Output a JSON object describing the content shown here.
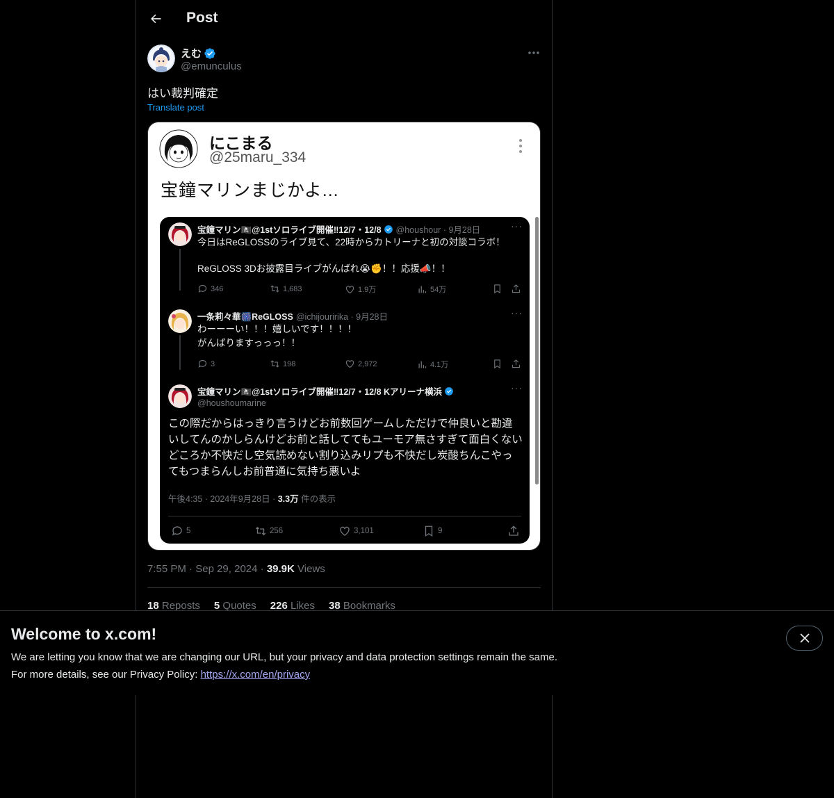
{
  "header": {
    "title": "Post"
  },
  "author": {
    "display_name": "えむ",
    "handle": "@emunculus"
  },
  "post": {
    "text": "はい裁判確定",
    "translate_label": "Translate post",
    "time": "7:55 PM",
    "date": "Sep 29, 2024",
    "views_count": "39.9K",
    "views_label": "Views"
  },
  "stats": [
    {
      "count": "18",
      "label": "Reposts"
    },
    {
      "count": "5",
      "label": "Quotes"
    },
    {
      "count": "226",
      "label": "Likes"
    },
    {
      "count": "38",
      "label": "Bookmarks"
    }
  ],
  "media": {
    "name": "にこまる",
    "handle": "@25maru_334",
    "text": "宝鐘マリンまじかよ...",
    "thread": {
      "first": {
        "name": "宝鐘マリン🏴‍☠️@1stソロライブ開催‼12/7・12/8",
        "meta": "@houshour · 9月28日",
        "line1": "今日はReGLOSSのライブ見て、22時からカトリーナと初の対談コラボ！",
        "line2": "ReGLOSS 3Dお披露目ライブがんばれ😭✊！！応援📣！！",
        "replies": "346",
        "reposts": "1,683",
        "likes": "1.9万",
        "views": "54万"
      },
      "second": {
        "name": "一条莉々華🎆ReGLOSS",
        "meta": "@ichijouririka · 9月28日",
        "line1": "わーーーい！！！嬉しいです！！！！",
        "line2": "がんばりますっっっ！！",
        "replies": "3",
        "reposts": "198",
        "likes": "2,972",
        "views": "4.1万"
      },
      "main": {
        "name": "宝鐘マリン🏴‍☠️@1stソロライブ開催‼12/7・12/8 Kアリーナ横浜",
        "handle": "@houshoumarine",
        "text": "この際だからはっきり言うけどお前数回ゲームしただけで仲良いと勘違いしてんのかしらんけどお前と話しててもユーモア無さすぎて面白くないどころか不快だし空気読めない割り込みリプも不快だし炭酸ちんこやってもつまらんしお前普通に気持ち悪いよ",
        "time": "午後4:35 · 2024年9月28日 · ",
        "views": "3.3万",
        "views_label": " 件の表示",
        "replies": "5",
        "reposts": "256",
        "likes": "3,101",
        "bookmarks": "9"
      }
    }
  },
  "banner": {
    "title": "Welcome to x.com!",
    "line1": "We are letting you know that we are changing our URL, but your privacy and data protection settings remain the same.",
    "line2": "For more details, see our Privacy Policy: ",
    "link": "https://x.com/en/privacy"
  },
  "colors": {
    "accent": "#1d9bf0",
    "link": "#a4a7f2",
    "muted": "#71767b",
    "text": "#e7e9ea",
    "border": "#2f3336"
  }
}
